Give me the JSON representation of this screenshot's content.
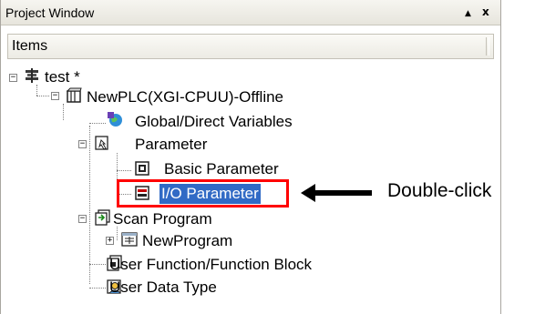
{
  "window": {
    "title": "Project Window",
    "buttons": {
      "up": "▲",
      "close": "x"
    }
  },
  "tree_header": {
    "label": "Items"
  },
  "tree": {
    "root": {
      "label": "test *",
      "icon": "project-icon",
      "expander": "−"
    },
    "plc": {
      "label": "NewPLC(XGI-CPUU)-Offline",
      "icon": "plc-icon",
      "expander": "−"
    },
    "global_vars": {
      "label": "Global/Direct Variables",
      "icon": "global-variables-icon"
    },
    "parameter": {
      "label": "Parameter",
      "icon": "parameter-icon",
      "expander": "−"
    },
    "basic_parameter": {
      "label": "Basic Parameter",
      "icon": "basic-parameter-icon"
    },
    "io_parameter": {
      "label": "I/O Parameter",
      "icon": "io-parameter-icon",
      "selected": true
    },
    "scan_program": {
      "label": "Scan Program",
      "icon": "scan-program-icon",
      "expander": "−"
    },
    "new_program": {
      "label": "NewProgram",
      "icon": "program-icon",
      "expander": "+"
    },
    "user_function": {
      "label": "User Function/Function Block",
      "icon": "function-block-icon"
    },
    "user_data_type": {
      "label": "User Data Type",
      "icon": "data-type-icon"
    }
  },
  "annotation": {
    "callout_text": "Double-click",
    "arrow_icon": "left-arrow-icon",
    "highlight_color": "#ff0000"
  },
  "colors": {
    "selection": "#316ac5",
    "titlebar": "#ecebe4"
  }
}
